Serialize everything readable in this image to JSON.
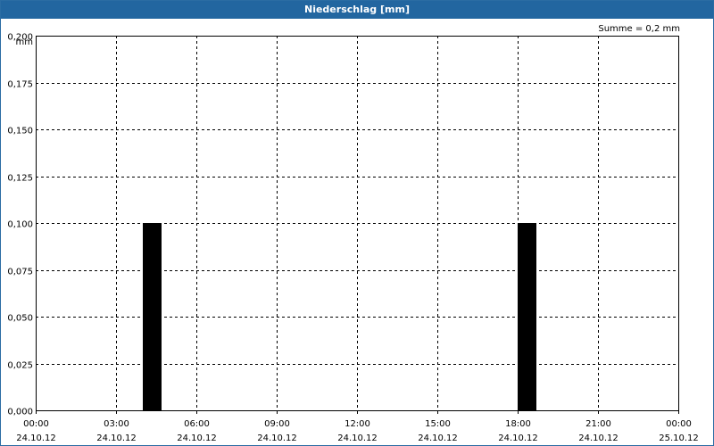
{
  "window": {
    "title": "Niederschlag [mm]"
  },
  "summary": "Summe = 0,2 mm",
  "chart_data": {
    "type": "bar",
    "title": "Niederschlag [mm]",
    "ylabel": "mm",
    "xlabel": "",
    "ylim": [
      0,
      0.2
    ],
    "y_ticks": [
      "0,000",
      "0,025",
      "0,050",
      "0,075",
      "0,100",
      "0,125",
      "0,150",
      "0,175",
      "0,200"
    ],
    "xlim_hours": [
      0,
      24
    ],
    "x_ticks": [
      {
        "hour": 0,
        "time": "00:00",
        "date": "24.10.12"
      },
      {
        "hour": 3,
        "time": "03:00",
        "date": "24.10.12"
      },
      {
        "hour": 6,
        "time": "06:00",
        "date": "24.10.12"
      },
      {
        "hour": 9,
        "time": "09:00",
        "date": "24.10.12"
      },
      {
        "hour": 12,
        "time": "12:00",
        "date": "24.10.12"
      },
      {
        "hour": 15,
        "time": "15:00",
        "date": "24.10.12"
      },
      {
        "hour": 18,
        "time": "18:00",
        "date": "24.10.12"
      },
      {
        "hour": 21,
        "time": "21:00",
        "date": "24.10.12"
      },
      {
        "hour": 24,
        "time": "00:00",
        "date": "25.10.12"
      }
    ],
    "bars": [
      {
        "start_hour": 4.0,
        "end_hour": 4.7,
        "value": 0.1
      },
      {
        "start_hour": 18.0,
        "end_hour": 18.7,
        "value": 0.1
      }
    ],
    "grid": true,
    "bar_color": "#000000"
  }
}
